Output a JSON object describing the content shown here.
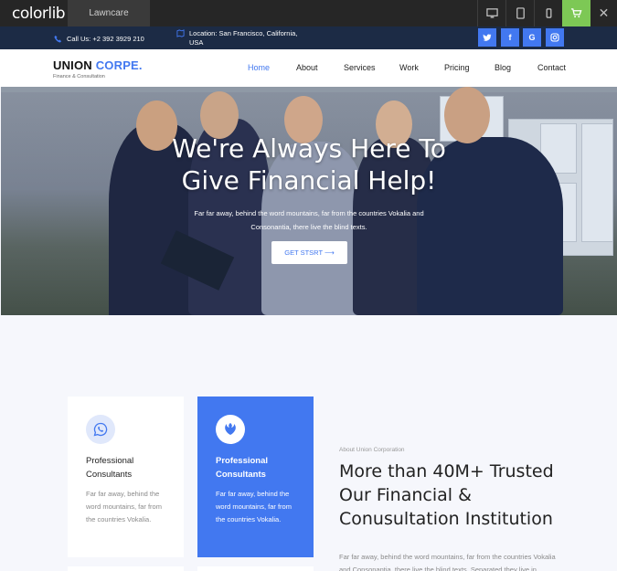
{
  "preview_bar": {
    "logo": "colorlib",
    "theme_tab": "Lawncare",
    "devices": [
      "desktop-icon",
      "tablet-icon",
      "mobile-icon"
    ],
    "cart_icon": "cart-icon",
    "close_label": "✕"
  },
  "topbar": {
    "phone": "Call Us: +2 392 3929 210",
    "location": "Location: San Francisco, California, USA",
    "social": [
      {
        "name": "twitter",
        "glyph": "🐦"
      },
      {
        "name": "facebook",
        "glyph": "f"
      },
      {
        "name": "google",
        "glyph": "G"
      },
      {
        "name": "instagram",
        "glyph": "◎"
      }
    ]
  },
  "brand": {
    "name_part1": "UNION",
    "name_part2": "CORPE.",
    "tagline": "Finance & Consultation"
  },
  "nav": [
    {
      "label": "Home",
      "active": true
    },
    {
      "label": "About",
      "active": false
    },
    {
      "label": "Services",
      "active": false
    },
    {
      "label": "Work",
      "active": false
    },
    {
      "label": "Pricing",
      "active": false
    },
    {
      "label": "Blog",
      "active": false
    },
    {
      "label": "Contact",
      "active": false
    }
  ],
  "hero": {
    "title_line1": "We're Always Here To",
    "title_line2": "Give Financial Help!",
    "subtitle": "Far far away, behind the word mountains, far from the countries Vokalia and Consonantia, there live the blind texts.",
    "button": "GET STSRT ⟶"
  },
  "services": [
    {
      "icon": "whatsapp-icon",
      "title": "Professional Consultants",
      "text": "Far far away, behind the word mountains, far from the countries Vokalia.",
      "highlight": false
    },
    {
      "icon": "rebel-icon",
      "title": "Professional Consultants",
      "text": "Far far away, behind the word mountains, far from the countries Vokalia.",
      "highlight": true
    }
  ],
  "about": {
    "label": "About Union Corporation",
    "title": "More than 40M+ Trusted Our Financial & Conusultation Institution",
    "text": "Far far away, behind the word mountains, far from the countries Vokalia and Consonantia, there live the blind texts. Separated they live in Bookmarksgrove right at the coast of the Semantics."
  },
  "colors": {
    "accent": "#4278f0",
    "topbar": "#1c2b45",
    "preview_bar": "#262626",
    "cart_green": "#7dc855"
  }
}
